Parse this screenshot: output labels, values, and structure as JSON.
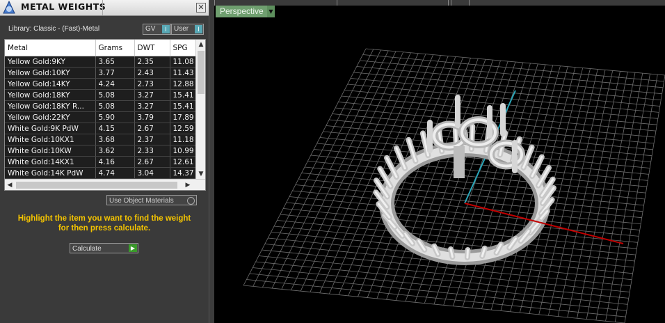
{
  "panel": {
    "title": "METAL WEIGHTS",
    "close_symbol": "✕",
    "library_label": "Library: Classic - (Fast)-Metal",
    "filters": [
      {
        "label": "GV",
        "icon": "dropdown-icon"
      },
      {
        "label": "User",
        "icon": "dropdown-icon"
      }
    ]
  },
  "table": {
    "columns": [
      "Metal",
      "Grams",
      "DWT",
      "SPG"
    ],
    "rows": [
      [
        "Yellow Gold:9KY",
        "3.65",
        "2.35",
        "11.08"
      ],
      [
        "Yellow Gold:10KY",
        "3.77",
        "2.43",
        "11.43"
      ],
      [
        "Yellow Gold:14KY",
        "4.24",
        "2.73",
        "12.88"
      ],
      [
        "Yellow Gold:18KY",
        "5.08",
        "3.27",
        "15.41"
      ],
      [
        "Yellow Gold:18KY R...",
        "5.08",
        "3.27",
        "15.41"
      ],
      [
        "Yellow Gold:22KY",
        "5.90",
        "3.79",
        "17.89"
      ],
      [
        "White Gold:9K PdW",
        "4.15",
        "2.67",
        "12.59"
      ],
      [
        "White Gold:10KX1",
        "3.68",
        "2.37",
        "11.18"
      ],
      [
        "White Gold:10KW",
        "3.62",
        "2.33",
        "10.99"
      ],
      [
        "White Gold:14KX1",
        "4.16",
        "2.67",
        "12.61"
      ],
      [
        "White Gold:14K PdW",
        "4.74",
        "3.04",
        "14.37"
      ]
    ]
  },
  "controls": {
    "use_object_materials": "Use Object Materials",
    "hint_line1": "Highlight the item you want to find the weight",
    "hint_line2": "for then press calculate.",
    "calculate_label": "Calculate"
  },
  "viewport": {
    "view_name": "Perspective",
    "axis_colors": {
      "x": "#c00000",
      "y": "#2aa6b8"
    }
  }
}
